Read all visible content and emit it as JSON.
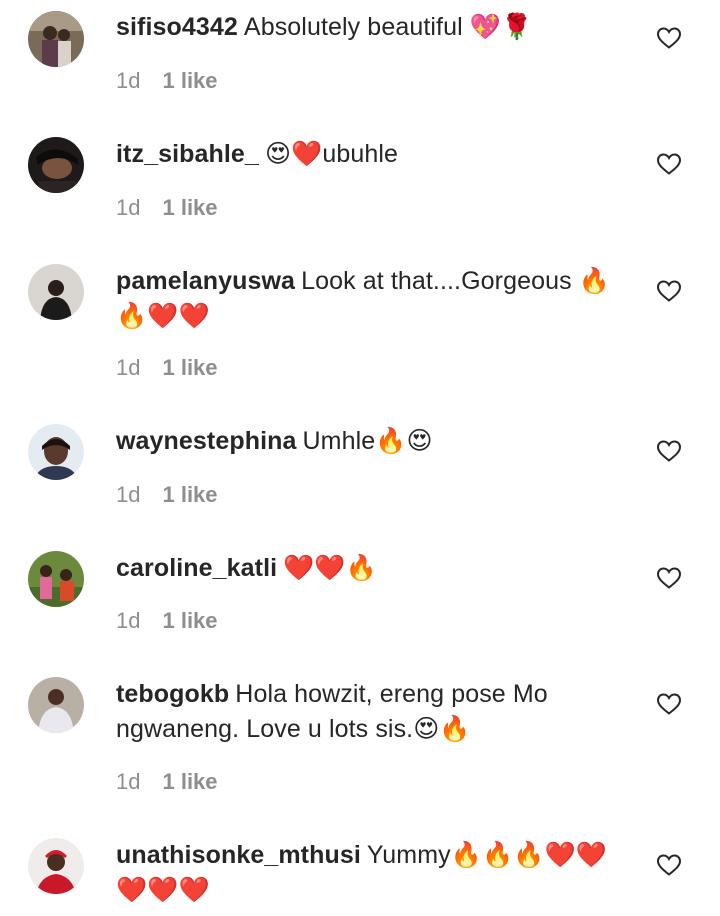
{
  "colors": {
    "text": "#262626",
    "muted": "#8e8e8e",
    "icon_stroke": "#262626",
    "fire": "#ff6a1a",
    "heart": "#e0162b"
  },
  "comments": [
    {
      "username": "sifiso4342",
      "text": "Absolutely beautiful 💖🌹",
      "time": "1d",
      "likes": "1 like",
      "avatar_icon": "avatar-photo"
    },
    {
      "username": "itz_sibahle_",
      "text": "😍❤️ubuhle",
      "time": "1d",
      "likes": "1 like",
      "avatar_icon": "avatar-photo"
    },
    {
      "username": "pamelanyuswa",
      "text": "Look at that....Gorgeous 🔥🔥❤️❤️",
      "time": "1d",
      "likes": "1 like",
      "avatar_icon": "avatar-photo"
    },
    {
      "username": "waynestephina",
      "text": "Umhle🔥😍",
      "time": "1d",
      "likes": "1 like",
      "avatar_icon": "avatar-photo"
    },
    {
      "username": "caroline_katli",
      "text": "❤️❤️🔥",
      "time": "1d",
      "likes": "1 like",
      "avatar_icon": "avatar-photo"
    },
    {
      "username": "tebogokb",
      "text": "Hola howzit, ereng pose Mo ngwaneng. Love u lots sis.😍🔥",
      "time": "1d",
      "likes": "1 like",
      "avatar_icon": "avatar-photo"
    },
    {
      "username": "unathisonke_mthusi",
      "text": "Yummy🔥🔥🔥❤️❤️❤️❤️❤️",
      "time": "",
      "likes": "",
      "avatar_icon": "avatar-photo"
    }
  ]
}
